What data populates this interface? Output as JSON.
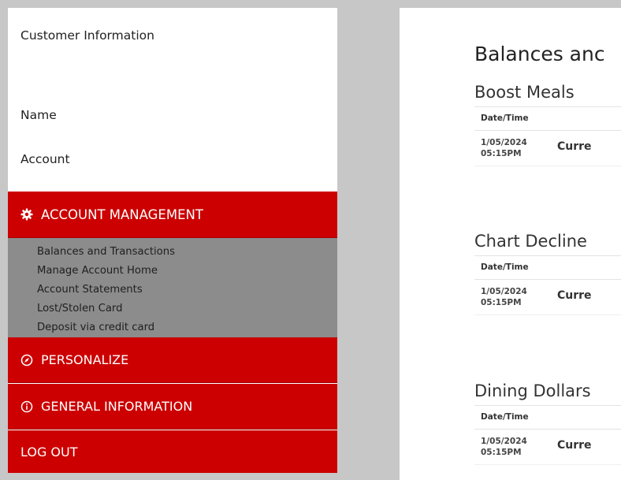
{
  "sidebar": {
    "customer_info_title": "Customer Information",
    "name_label": "Name",
    "account_label": "Account",
    "menu": {
      "account_management": {
        "label": "ACCOUNT MANAGEMENT",
        "icon": "gear-icon",
        "items": [
          {
            "label": "Balances and Transactions"
          },
          {
            "label": "Manage Account Home"
          },
          {
            "label": "Account Statements"
          },
          {
            "label": "Lost/Stolen Card"
          },
          {
            "label": "Deposit via credit card"
          }
        ]
      },
      "personalize": {
        "label": "PERSONALIZE",
        "icon": "compass-icon"
      },
      "general_information": {
        "label": "GENERAL INFORMATION",
        "icon": "info-icon"
      },
      "log_out": {
        "label": "LOG OUT"
      }
    }
  },
  "main": {
    "page_title": "Balances anc",
    "sections": [
      {
        "title": "Boost Meals",
        "header": "Date/Time",
        "row": {
          "date": "1/05/2024",
          "time": "05:15PM",
          "type": "Curre"
        }
      },
      {
        "title": "Chart Decline",
        "header": "Date/Time",
        "row": {
          "date": "1/05/2024",
          "time": "05:15PM",
          "type": "Curre"
        }
      },
      {
        "title": "Dining Dollars",
        "header": "Date/Time",
        "row": {
          "date": "1/05/2024",
          "time": "05:15PM",
          "type": "Curre"
        }
      }
    ]
  },
  "colors": {
    "brand_red": "#cc0000",
    "submenu_gray": "#8c8c8c",
    "page_bg": "#c7c7c7"
  }
}
